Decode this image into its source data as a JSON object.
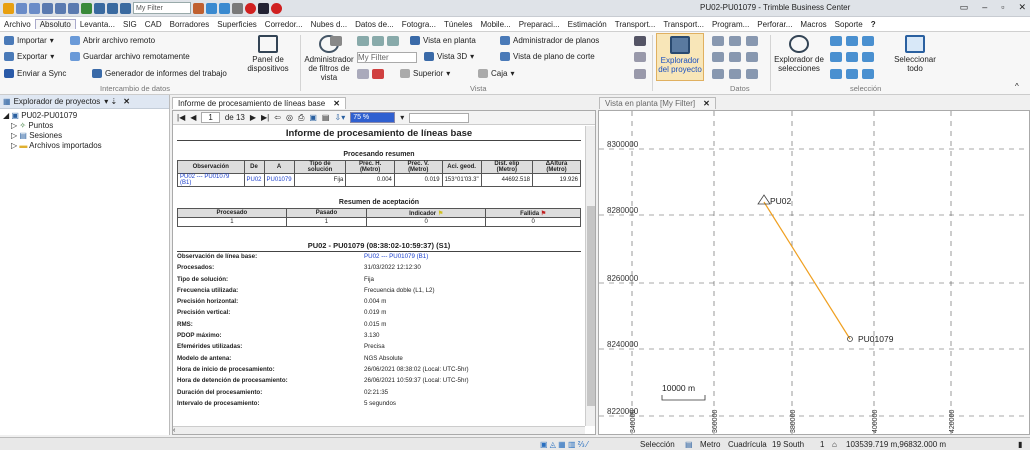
{
  "window": {
    "title": "PU02-PU01079 - Trimble Business Center",
    "filter_placeholder": "My Filter"
  },
  "menu": [
    "Archivo",
    "Absoluto",
    "Levanta...",
    "SIG",
    "CAD",
    "Borradores",
    "Superficies",
    "Corredor...",
    "Nubes d...",
    "Datos de...",
    "Fotogra...",
    "Túneles",
    "Mobile...",
    "Preparaci...",
    "Estimación",
    "Transport...",
    "Transport...",
    "Program...",
    "Perforar...",
    "Macros",
    "Soporte"
  ],
  "ribbon": {
    "importar": "Importar",
    "abrir_remoto": "Abrir archivo remoto",
    "exportar": "Exportar",
    "guardar_remoto": "Guardar archivo remotamente",
    "enviar_sync": "Enviar a Sync",
    "generador": "Generador de informes del trabajo",
    "panel_disp": "Panel de dispositivos",
    "group1": "Intercambio de datos",
    "admin_filtros": "Administrador de filtros de vista",
    "filter_value": "My Filter",
    "vista_planta": "Vista en planta",
    "vista_3d": "Vista 3D",
    "superior": "Superior",
    "caja": "Caja",
    "admin_planos": "Administrador de planos",
    "vista_corte": "Vista de plano de corte",
    "group2": "Vista",
    "explorador_proyecto": "Explorador del proyecto",
    "group3": "Datos",
    "explorador_sel": "Explorador de selecciones",
    "seleccionar_todo": "Seleccionar todo",
    "group4": "selección"
  },
  "project_explorer": {
    "title": "Explorador de proyectos",
    "root": "PU02-PU01079",
    "items": [
      "Puntos",
      "Sesiones",
      "Archivos importados"
    ]
  },
  "tabs": {
    "report": "Informe de procesamiento de líneas base",
    "plan": "Vista en planta [My Filter]"
  },
  "report_toolbar": {
    "page": "1",
    "of": "de 13",
    "zoom": "75 %"
  },
  "report": {
    "title": "Informe de procesamiento de líneas base",
    "summary_title": "Procesando resumen",
    "summary_headers": [
      "Observación",
      "De",
      "A",
      "Tipo de solución",
      "Prec. H. (Metro)",
      "Prec. V. (Metro)",
      "Aci. geod.",
      "Dist. elip (Metro)",
      "ΔAltura (Metro)"
    ],
    "summary_row": [
      "PU02 --- PU01079 (B1)",
      "PU02",
      "PU01079",
      "Fija",
      "0.004",
      "0.019",
      "153°01'03.3\"",
      "44692.518",
      "19.926"
    ],
    "accept_title": "Resumen de aceptación",
    "accept_headers": [
      "Procesado",
      "Pasado",
      "Indicador",
      "Fallida"
    ],
    "accept_row": [
      "1",
      "1",
      "0",
      "0"
    ],
    "detail_title": "PU02 - PU01079 (08:38:02-10:59:37) (S1)",
    "details": [
      {
        "k": "Observación de línea base:",
        "v": "PU02 --- PU01079 (B1)"
      },
      {
        "k": "Procesados:",
        "v": "31/03/2022 12:12:30"
      },
      {
        "k": "Tipo de solución:",
        "v": "Fija"
      },
      {
        "k": "Frecuencia utilizada:",
        "v": "Frecuencia doble (L1, L2)"
      },
      {
        "k": "Precisión horizontal:",
        "v": "0.004 m"
      },
      {
        "k": "Precisión vertical:",
        "v": "0.019 m"
      },
      {
        "k": "RMS:",
        "v": "0.015 m"
      },
      {
        "k": "PDOP máximo:",
        "v": "3.130"
      },
      {
        "k": "Efemérides utilizadas:",
        "v": "Precisa"
      },
      {
        "k": "Modelo de antena:",
        "v": "NGS Absolute"
      },
      {
        "k": "Hora de inicio de procesamiento:",
        "v": "26/06/2021 08:38:02 (Local: UTC-5hr)"
      },
      {
        "k": "Hora de detención de procesamiento:",
        "v": "26/06/2021 10:59:37 (Local: UTC-5hr)"
      },
      {
        "k": "Duración del procesamiento:",
        "v": "02:21:35"
      },
      {
        "k": "Intervalo de procesamiento:",
        "v": "5 segundos"
      }
    ]
  },
  "plan": {
    "y_labels": [
      "8300000",
      "8280000",
      "8260000",
      "8240000",
      "8220000"
    ],
    "x_labels": [
      "340000",
      "360000",
      "380000",
      "400000",
      "420000"
    ],
    "points": [
      "PU02",
      "PU01079"
    ],
    "scale": "10000 m",
    "line_color": "#f0a020"
  },
  "status": {
    "seleccion": "Selección",
    "unidad": "Metro",
    "cuadricula": "Cuadrícula",
    "zona": "19 South",
    "count": "1",
    "coords": "103539.719 m,96832.000 m"
  },
  "colors": {
    "accent": "#3060d0",
    "header_bg": "#dfe7f2"
  }
}
